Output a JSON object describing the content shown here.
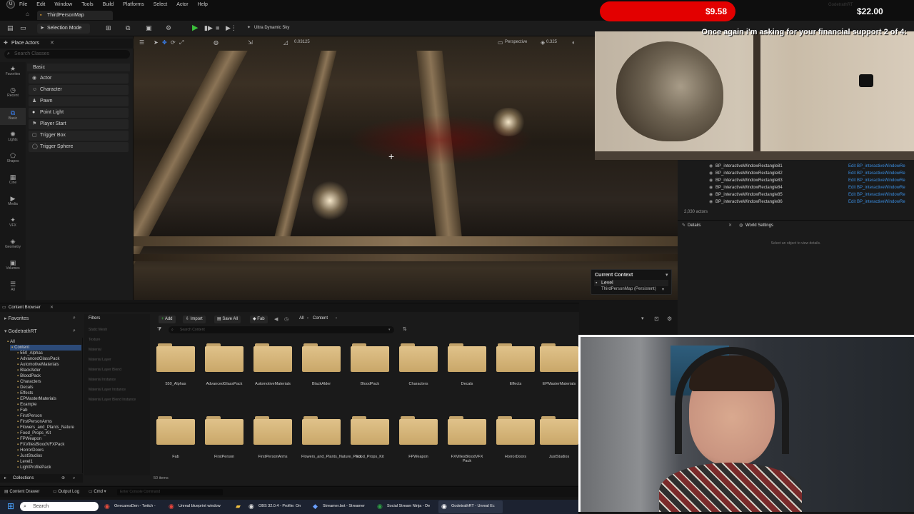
{
  "menu": [
    "File",
    "Edit",
    "Window",
    "Tools",
    "Build",
    "Platforms",
    "Select",
    "Actor",
    "Help"
  ],
  "editor": {
    "map_tab": "ThirdPersonMap",
    "selection_mode": "Selection Mode",
    "sky_label": "Ultra Dynamic Sky"
  },
  "place_actors": {
    "title": "Place Actors",
    "search_placeholder": "Search Classes",
    "category": "Basic",
    "rail": [
      {
        "icon": "★",
        "label": "Favorites"
      },
      {
        "icon": "◷",
        "label": "Recent"
      },
      {
        "icon": "⧉",
        "label": "Basic"
      },
      {
        "icon": "✺",
        "label": "Lights"
      },
      {
        "icon": "⬠",
        "label": "Shapes"
      },
      {
        "icon": "▦",
        "label": "Cine"
      },
      {
        "icon": "▶",
        "label": "Media"
      },
      {
        "icon": "✦",
        "label": "VFX"
      },
      {
        "icon": "◈",
        "label": "Geometry"
      },
      {
        "icon": "▣",
        "label": "Volumes"
      },
      {
        "icon": "☰",
        "label": "All"
      }
    ],
    "items": [
      "Actor",
      "Character",
      "Pawn",
      "Point Light",
      "Player Start",
      "Trigger Box",
      "Trigger Sphere"
    ]
  },
  "viewport": {
    "mode": "Perspective",
    "grid_value": "0.03125",
    "rot_value": "0.325",
    "context_title": "Current Context",
    "context_level": "Level",
    "context_map": "ThirdPersonMap (Persistent)"
  },
  "stream": {
    "donation_current": "$9.58",
    "donation_goal": "$22.00",
    "message": "Once again i'm asking for your financial support 2 of 4:",
    "username": "GodetrathRT"
  },
  "outliner": {
    "rows": [
      {
        "name": "BP_interactiveWindowRectangle81",
        "action": "Edit BP_interactiveWindowRe"
      },
      {
        "name": "BP_interactiveWindowRectangle82",
        "action": "Edit BP_interactiveWindowRe"
      },
      {
        "name": "BP_interactiveWindowRectangle83",
        "action": "Edit BP_interactiveWindowRe"
      },
      {
        "name": "BP_interactiveWindowRectangle84",
        "action": "Edit BP_interactiveWindowRe"
      },
      {
        "name": "BP_interactiveWindowRectangle85",
        "action": "Edit BP_interactiveWindowRe"
      },
      {
        "name": "BP_interactiveWindowRectangle86",
        "action": "Edit BP_interactiveWindowRe"
      }
    ],
    "actor_count": "2,030 actors"
  },
  "details": {
    "tab_details": "Details",
    "tab_world": "World Settings",
    "empty_msg": "Select an object to view details."
  },
  "content_browser": {
    "title": "Content Browser",
    "favorites": "Favorites",
    "project": "GodetrathRT",
    "filters": "Filters",
    "add": "Add",
    "import": "Import",
    "save_all": "Save All",
    "fab": "Fab",
    "path_all": "All",
    "path_content": "Content",
    "search_placeholder": "Search Content",
    "filter_items": [
      "Static Mesh",
      "Texture",
      "Material",
      "Material Layer",
      "Material Layer Blend",
      "Material Instance",
      "Material Layer Instance",
      "Material Layer Blend Instance"
    ],
    "tree": [
      "All",
      "Content",
      "550_Alphas",
      "AdvancedGlassPack",
      "AutomotiveMaterials",
      "BlackAlder",
      "BloodPack",
      "Characters",
      "Decals",
      "Effects",
      "EPMasterMaterials",
      "Example",
      "Fab",
      "FirstPerson",
      "FirstPersonArms",
      "Flowers_and_Plants_Nature",
      "Food_Props_Kit",
      "FPWeapon",
      "FXVillesBloodVFXPack",
      "HorrorDoors",
      "JustStudios",
      "Level1",
      "LightProfilePack"
    ],
    "folders_row1": [
      "550_Alphas",
      "AdvancedGlassPack",
      "AutomotiveMaterials",
      "BlackAlder",
      "BloodPack",
      "Characters",
      "Decals",
      "Effects",
      "EPMasterMaterials"
    ],
    "folders_row2": [
      "Fab",
      "FirstPerson",
      "FirstPersonArms",
      "Flowers_and_Plants_Nature_Pack",
      "Food_Props_Kit",
      "FPWeapon",
      "FXVillesBloodVFX Pack",
      "HorrorDoors",
      "JustStudios"
    ],
    "item_count": "50 items",
    "collections": "Collections"
  },
  "statusbar": {
    "content_drawer": "Content Drawer",
    "output_log": "Output Log",
    "cmd": "Cmd",
    "cmd_placeholder": "Enter Console Command"
  },
  "taskbar": {
    "search": "Search",
    "apps": [
      {
        "label": "OnecaresDen - Twitch -",
        "color": "#8a3ffc"
      },
      {
        "label": "Unreal blueprint window",
        "color": "#e8453c"
      },
      {
        "label": "OBS 32.0.4 - Profile: On",
        "color": "#444444"
      },
      {
        "label": "Streamer.bot - Streamer",
        "color": "#3d6ee8"
      },
      {
        "label": "Social Stream Ninja - De",
        "color": "#2ea043"
      },
      {
        "label": "GodetrathRT - Unreal Ec",
        "color": "#dddddd"
      }
    ]
  }
}
